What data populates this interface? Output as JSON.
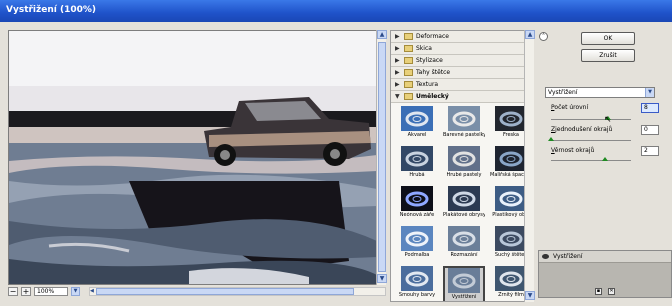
{
  "window": {
    "title": "Vystřižení (100%)"
  },
  "preview": {
    "zoom": "100%",
    "zoom_out_label": "−",
    "zoom_in_label": "+"
  },
  "gallery": {
    "categories": [
      {
        "label": "Deformace",
        "expanded": false
      },
      {
        "label": "Skica",
        "expanded": false
      },
      {
        "label": "Stylizace",
        "expanded": false
      },
      {
        "label": "Tahy štětce",
        "expanded": false
      },
      {
        "label": "Textura",
        "expanded": false
      },
      {
        "label": "Umělecký",
        "expanded": true
      }
    ],
    "filters": [
      {
        "label": "Akvarel",
        "selected": false
      },
      {
        "label": "Barevné pastelky",
        "selected": false
      },
      {
        "label": "Freska",
        "selected": false
      },
      {
        "label": "Hrubá",
        "selected": false
      },
      {
        "label": "Hrubé pastely",
        "selected": false
      },
      {
        "label": "Malířská špachtle",
        "selected": false
      },
      {
        "label": "Neónová záře",
        "selected": false
      },
      {
        "label": "Plakátové obrysy",
        "selected": false
      },
      {
        "label": "Plastikový obal",
        "selected": false
      },
      {
        "label": "Podmalba",
        "selected": false
      },
      {
        "label": "Rozmazání",
        "selected": false
      },
      {
        "label": "Suchý štětec",
        "selected": false
      },
      {
        "label": "Smouhy barvy",
        "selected": false
      },
      {
        "label": "Vystřižení",
        "selected": true
      },
      {
        "label": "Zrnitý film",
        "selected": false
      }
    ]
  },
  "actions": {
    "ok_label": "OK",
    "cancel_label": "Zrušit"
  },
  "filter_select": {
    "value": "Vystřižení"
  },
  "params": [
    {
      "label_key": "P",
      "label_rest": "očet úrovní",
      "value": "8",
      "fraction": 0.71
    },
    {
      "label_key": "Z",
      "label_rest": "jednodušení okrajů",
      "value": "0",
      "fraction": 0.0
    },
    {
      "label_key": "V",
      "label_rest": "ěrnost okrajů",
      "value": "2",
      "fraction": 0.67
    }
  ],
  "layers": {
    "items": [
      {
        "label": "Vystřižení",
        "visible": true
      }
    ]
  }
}
